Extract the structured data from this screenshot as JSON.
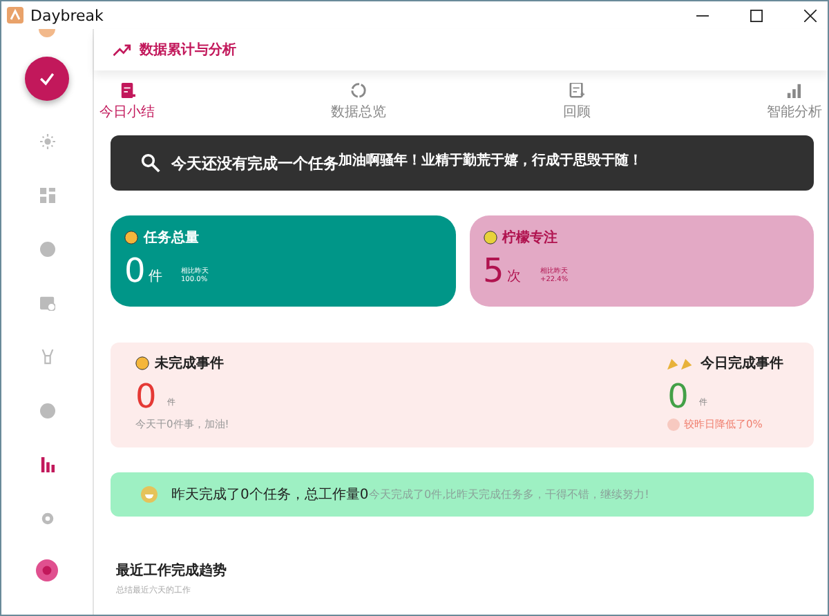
{
  "window": {
    "title": "Daybreak"
  },
  "sidebar": {
    "items": [
      {
        "selected": false
      },
      {
        "selected": false
      },
      {
        "selected": false
      },
      {
        "selected": false
      },
      {
        "selected": false
      },
      {
        "selected": false
      },
      {
        "selected": true
      },
      {
        "selected": false
      }
    ]
  },
  "header": {
    "title": "数据累计与分析"
  },
  "tabs": [
    {
      "label": "今日小结",
      "selected": true
    },
    {
      "label": "数据总览",
      "selected": false
    },
    {
      "label": "回顾",
      "selected": false
    },
    {
      "label": "智能分析",
      "selected": false
    }
  ],
  "banner": {
    "title": "今天还没有完成一个任务",
    "subtitle": "加油啊骚年！业精于勤荒于嬉，行成于思毁于随！"
  },
  "cards": [
    {
      "title": "任务总量",
      "value": "0",
      "unit": "件",
      "compare_label": "相比昨天",
      "compare_value": "100.0%",
      "color": "#009688"
    },
    {
      "title": "柠檬专注",
      "value": "5",
      "unit": "次",
      "compare_label": "相比昨天",
      "compare_value": "+22.4%",
      "color": "#e3a9c5"
    }
  ],
  "events": {
    "pending": {
      "title": "未完成事件",
      "value": "0",
      "unit": "件",
      "note": "今天干0件事，加油!"
    },
    "done": {
      "title": "今日完成事件",
      "value": "0",
      "unit": "件",
      "note": "较昨日降低了0%"
    }
  },
  "summary": {
    "title": "昨天完成了0个任务，总工作量0",
    "note": "今天完成了0件,比昨天完成任务多，干得不错，继续努力!"
  },
  "trend": {
    "title": "最近工作完成趋势",
    "subtitle": "总结最近六天的工作"
  }
}
